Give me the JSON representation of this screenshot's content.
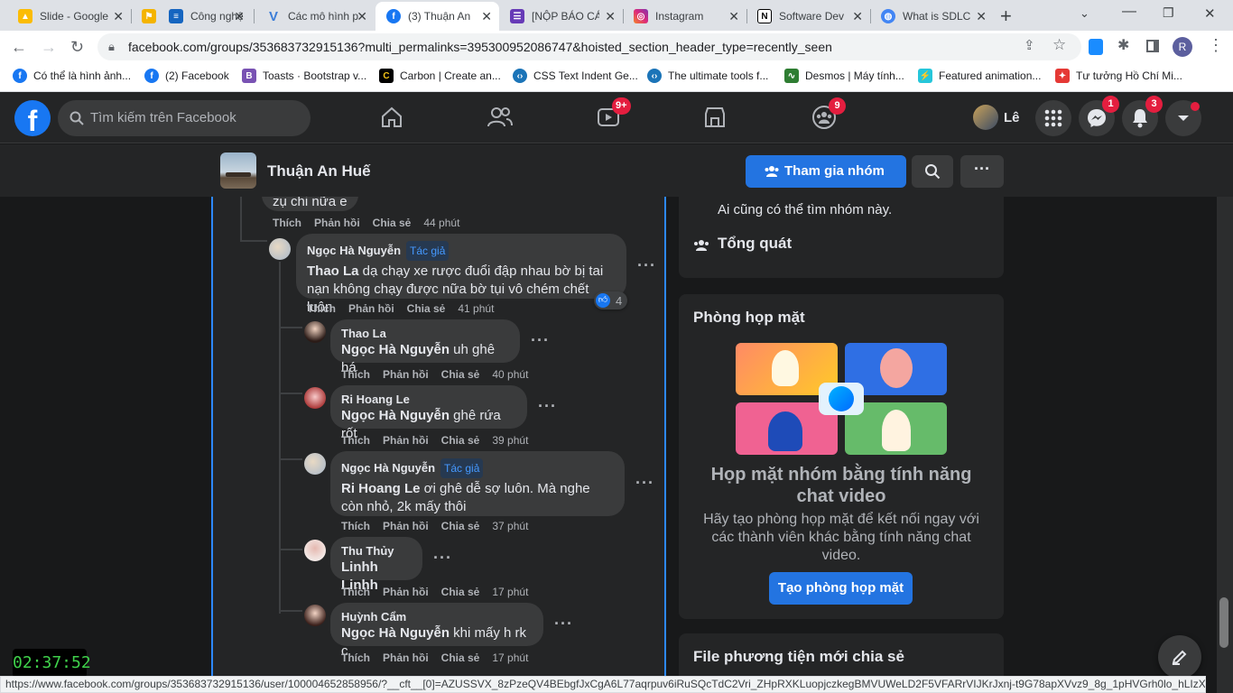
{
  "browser": {
    "tabs": [
      {
        "title": "Slide - Google",
        "favicon": "google-drive-icon",
        "color": "#fbbc04"
      },
      {
        "title": "",
        "favicon": "flag-icon",
        "color": "#f4b400"
      },
      {
        "title": "Công nghệ",
        "favicon": "stack-icon",
        "color": "#1565c0"
      },
      {
        "title": "Các mô hình p",
        "favicon": "v-icon",
        "color": "#3b7dd8"
      },
      {
        "title": "(3) Thuận An",
        "favicon": "facebook-icon",
        "color": "#1877f2"
      },
      {
        "title": "[NỘP BÁO CÁ",
        "favicon": "forms-icon",
        "color": "#673ab7"
      },
      {
        "title": "Instagram",
        "favicon": "instagram-icon",
        "color": "#e1306c"
      },
      {
        "title": "Software Dev",
        "favicon": "notion-icon",
        "color": "#000000"
      },
      {
        "title": "What is SDLC",
        "favicon": "globe-icon",
        "color": "#4285f4"
      }
    ],
    "url": "facebook.com/groups/353683732915136?multi_permalinks=395300952086747&hoisted_section_header_type=recently_seen",
    "profile_initial": "R",
    "bookmarks": [
      {
        "label": "Có thể là hình ảnh...",
        "color": "#1877f2"
      },
      {
        "label": "(2) Facebook",
        "color": "#1877f2"
      },
      {
        "label": "Toasts · Bootstrap v...",
        "color": "#7952b3"
      },
      {
        "label": "Carbon | Create an...",
        "color": "#000000"
      },
      {
        "label": "CSS Text Indent Ge...",
        "color": "#1b74b8"
      },
      {
        "label": "The ultimate tools f...",
        "color": "#1b74b8"
      },
      {
        "label": "Desmos | Máy tính...",
        "color": "#2e7d32"
      },
      {
        "label": "Featured animation...",
        "color": "#26c6da"
      },
      {
        "label": "Tư tưởng Hồ Chí Mi...",
        "color": "#e53935"
      }
    ],
    "status_url": "https://www.facebook.com/groups/353683732915136/user/100004652858956/?__cft__[0]=AZUSSVX_8zPzeQV4BEbgfJxCgA6L77aqrpuv6iRuSQcTdC2Vri_ZHpRXKLuopjczkegBMVUWeLD2F5VFARrVIJKrJxnj-t9G78apXVvz9_8g_1pHVGrh0lo_hLIzXEAY8Qf..."
  },
  "fb": {
    "logo": "f",
    "search_placeholder": "Tìm kiếm trên Facebook",
    "watch_badge": "9+",
    "groups_badge": "9",
    "user_name": "Lê",
    "messenger_badge": "1",
    "notif_badge": "3"
  },
  "group": {
    "name": "Thuận An Huế",
    "join_button": "Tham gia nhóm",
    "accent": "#2374e1"
  },
  "comments": {
    "top_partial": "zụ chi nữa e",
    "top_actions": {
      "like": "Thích",
      "reply": "Phản hồi",
      "share": "Chia sẻ",
      "time": "44 phút"
    },
    "main": {
      "author": "Ngọc Hà Nguyễn",
      "badge": "Tác giả",
      "mention": "Thao La",
      "text": " dạ chạy xe rược đuổi đập nhau bờ bị tai nạn không chạy được nữa bờ tụi vô chém chết luôn",
      "reactions": "4",
      "time": "41 phút"
    },
    "replies": [
      {
        "author": "Thao La",
        "mention": "Ngọc Hà Nguyễn",
        "text": " uh ghê há",
        "time": "40 phút",
        "badge": ""
      },
      {
        "author": "Ri Hoang Le",
        "mention": "Ngọc Hà Nguyễn",
        "text": " ghê rứa rốt",
        "time": "39 phút",
        "badge": ""
      },
      {
        "author": "Ngọc Hà Nguyễn",
        "mention": "Ri Hoang Le",
        "text": " ơi ghê dễ sợ luôn. Mà nghe còn nhỏ, 2k mấy thôi",
        "time": "37 phút",
        "badge": "Tác giả"
      },
      {
        "author": "Thu Thủy",
        "mention": "Linhh Linhh",
        "text": "",
        "time": "17 phút",
        "badge": ""
      },
      {
        "author": "Huỳnh Cẩm",
        "mention": "Ngọc Hà Nguyễn",
        "text": " khi mấy h rk c",
        "time": "17 phút",
        "badge": ""
      }
    ],
    "action_like": "Thích",
    "action_reply": "Phản hồi",
    "action_share": "Chia sẻ"
  },
  "sidebar": {
    "visibility_text": "Ai cũng có thể tìm nhóm này.",
    "overview_label": "Tổng quát",
    "rooms_title": "Phòng họp mặt",
    "rooms_heading": "Họp mặt nhóm bằng tính năng chat video",
    "rooms_desc": "Hãy tạo phòng họp mặt để kết nối ngay với các thành viên khác bằng tính năng chat video.",
    "rooms_button": "Tạo phòng họp mặt",
    "media_title": "File phương tiện mới chia sẻ"
  },
  "clock": "02:37:52"
}
